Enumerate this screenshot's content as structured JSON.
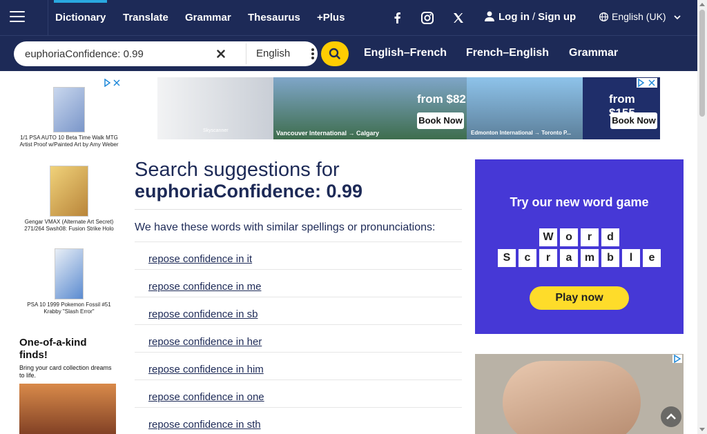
{
  "nav": {
    "menu_label": "Menu",
    "links": [
      {
        "label": "Dictionary"
      },
      {
        "label": "Translate"
      },
      {
        "label": "Grammar"
      },
      {
        "label": "Thesaurus"
      },
      {
        "label": "+Plus"
      }
    ],
    "login": "Log in",
    "separator": "/",
    "signup": "Sign up",
    "language": "English (UK)"
  },
  "search": {
    "value": "euphoriaConfidence: 0.99",
    "language": "English"
  },
  "dictionaries": [
    {
      "label": "English–French"
    },
    {
      "label": "French–English"
    },
    {
      "label": "Grammar"
    }
  ],
  "ads": {
    "left": [
      {
        "caption": "1/1 PSA AUTO 10 Beta Time Walk MTG Artist Proof w/Painted Art by Amy Weber"
      },
      {
        "caption": "Gengar VMAX (Alternate Art Secret) 271/264 Swsh08: Fusion Strike Holo"
      },
      {
        "caption": "PSA 10 1999 Pokemon Fossil #51 Krabby \"Slash Error\""
      }
    ],
    "left_promo_title": "One-of-a-kind finds!",
    "left_promo_sub": "Bring your card collection dreams to life.",
    "top": {
      "brand": "Skyscanner",
      "route1": "Vancouver International → Calgary",
      "price1": "from $82",
      "cta1": "Book Now",
      "route2": "Edmonton International → Toronto P...",
      "price2": "from $155",
      "cta2": "Book Now"
    },
    "right": {
      "headline": "Try our new word game",
      "row1": [
        "W",
        "o",
        "r",
        "d"
      ],
      "row2": [
        "S",
        "c",
        "r",
        "a",
        "m",
        "b",
        "l",
        "e"
      ],
      "cta": "Play now"
    }
  },
  "main": {
    "heading_prefix": "Search suggestions for",
    "heading_term": "euphoriaConfidence: 0.99",
    "intro": "We have these words with similar spellings or pronunciations:",
    "suggestions": [
      "repose confidence in it",
      "repose confidence in me",
      "repose confidence in sb",
      "repose confidence in her",
      "repose confidence in him",
      "repose confidence in one",
      "repose confidence in sth"
    ]
  },
  "colors": {
    "header_bg": "#1d2a57",
    "accent_yellow": "#fecc02",
    "game_purple": "#4638d6"
  }
}
